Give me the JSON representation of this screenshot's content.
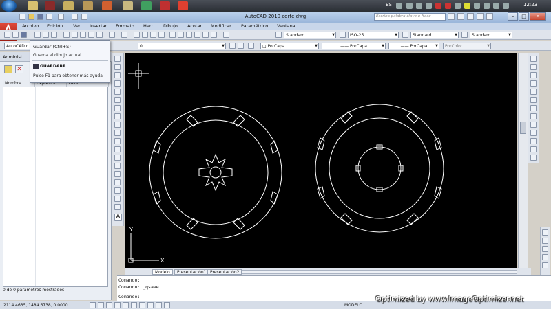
{
  "taskbar": {
    "language": "ES",
    "clock": "12:23"
  },
  "window": {
    "title": "AutoCAD 2010     corte.dwg",
    "search_placeholder": "Escriba palabra clave o frase"
  },
  "menu": [
    "Archivo",
    "Edición",
    "Ver",
    "Insertar",
    "Formato",
    "Herr.",
    "Dibujo",
    "Acotar",
    "Modificar",
    "Paramétrico",
    "Ventana"
  ],
  "toolbar": {
    "text_style": "Standard",
    "dim_style": "ISO-25",
    "table_style": "Standard",
    "multileader_style": "Standard",
    "workspace": "AutoCAD c",
    "layer": "0",
    "color": "PorCapa",
    "linetype": "PorCapa",
    "lineweight": "PorCapa",
    "plotstyle": "PorColor"
  },
  "tooltip": {
    "title": "Guardar (Ctrl+S)",
    "desc": "Guarda el dibujo actual",
    "command": "GUARDARR",
    "help": "Pulse F1 para obtener más ayuda"
  },
  "params_panel": {
    "title": "Administ",
    "columns": [
      "Nombre",
      "Expresión",
      "Valor"
    ],
    "status": "0 de 0 parámetros mostrados"
  },
  "tabs": [
    "Modelo",
    "Presentación1",
    "Presentación2"
  ],
  "command": {
    "line1": "Comando:",
    "line2": "Comando: _qsave",
    "prompt": "Comando:"
  },
  "status": {
    "coords": "2114.4635, 1484.6738, 0.0000",
    "mode": "MODELO"
  },
  "ucs": {
    "x": "X",
    "y": "Y"
  },
  "watermark": "Optimized by www.ImageOptimizer.net"
}
